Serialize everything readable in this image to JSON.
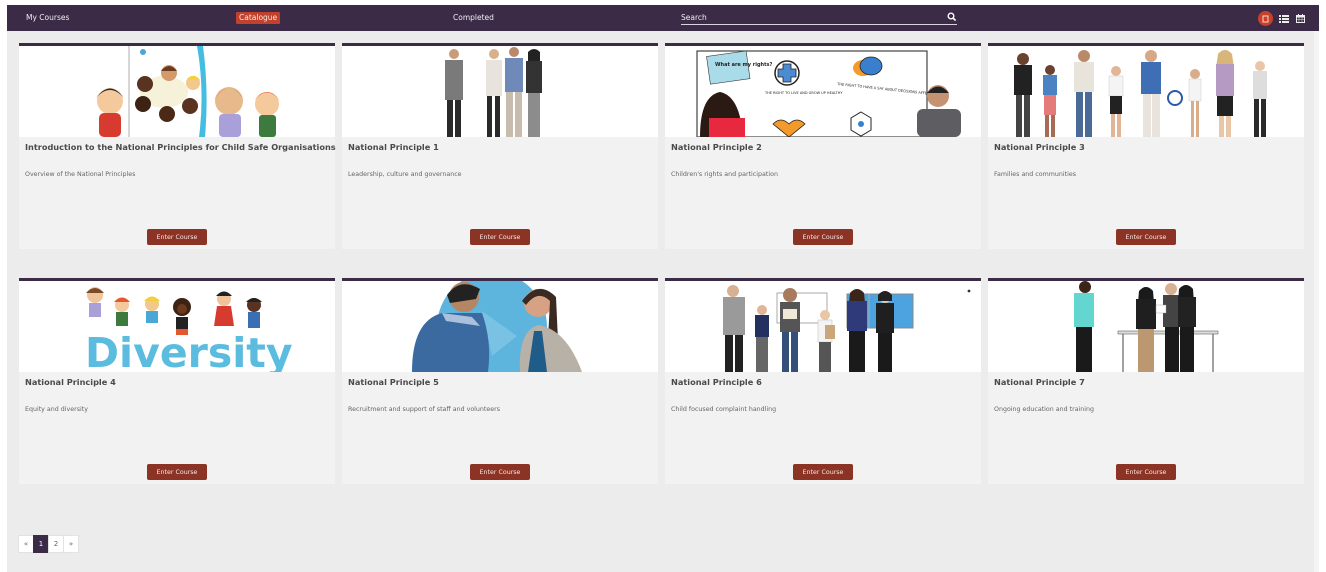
{
  "nav": {
    "links": [
      {
        "label": "My Courses",
        "active": false
      },
      {
        "label": "Catalogue",
        "active": true
      },
      {
        "label": "Completed",
        "active": false
      }
    ],
    "search": {
      "placeholder": "Search",
      "value": ""
    },
    "view_modes": [
      {
        "icon": "tile-view-icon",
        "active": true
      },
      {
        "icon": "list-view-icon",
        "active": false
      },
      {
        "icon": "calendar-view-icon",
        "active": false
      }
    ]
  },
  "colors": {
    "nav_bg": "#3b2b47",
    "accent": "#c0412c",
    "button": "#8b3324",
    "card_bg": "#f2f2f2",
    "page_bg": "#ececec"
  },
  "courses": [
    {
      "title": "Introduction to the National Principles for Child Safe Organisations",
      "description": "Overview of the National Principles",
      "button": "Enter Course",
      "image": "cartoon-children-illustration"
    },
    {
      "title": "National Principle 1",
      "description": "Leadership, culture and governance",
      "button": "Enter Course",
      "image": "business-people-photo"
    },
    {
      "title": "National Principle 2",
      "description": "Children's rights and participation",
      "button": "Enter Course",
      "image": "rights-whiteboard-photo"
    },
    {
      "title": "National Principle 3",
      "description": "Families and communities",
      "button": "Enter Course",
      "image": "families-group-photo"
    },
    {
      "title": "National Principle 4",
      "description": "Equity and diversity",
      "button": "Enter Course",
      "image": "diversity-illustration"
    },
    {
      "title": "National Principle 5",
      "description": "Recruitment and support of staff and volunteers",
      "button": "Enter Course",
      "image": "interview-photo"
    },
    {
      "title": "National Principle 6",
      "description": "Child focused complaint handling",
      "button": "Enter Course",
      "image": "school-staff-photo"
    },
    {
      "title": "National Principle 7",
      "description": "Ongoing education and training",
      "button": "Enter Course",
      "image": "training-photo"
    }
  ],
  "image_text": {
    "rights_sticky": "What are my rights?",
    "rights_1": "THE RIGHT TO LIVE AND GROW UP HEALTHY",
    "rights_2": "THE RIGHT TO HAVE A SAY ABOUT DECISIONS AFFECTING YOU",
    "diversity_word": "Diversity"
  },
  "pagination": {
    "prev": "«",
    "pages": [
      "1",
      "2"
    ],
    "current": "1",
    "next": "»"
  }
}
